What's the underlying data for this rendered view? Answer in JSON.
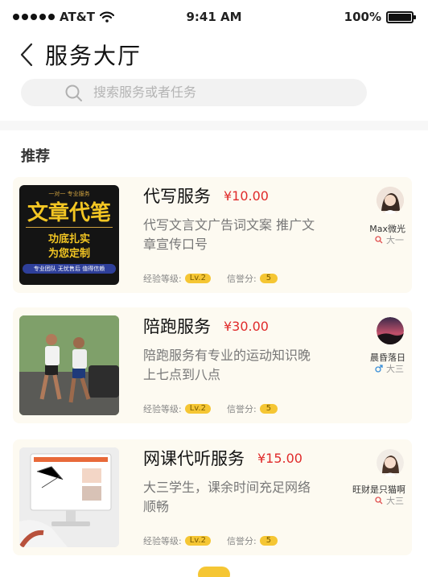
{
  "status_bar": {
    "carrier": "AT&T",
    "time": "9:41 AM",
    "battery": "100%"
  },
  "header": {
    "title": "服务大厅"
  },
  "search": {
    "placeholder": "搜索服务或者任务"
  },
  "section": {
    "title": "推荐"
  },
  "meta_labels": {
    "level": "经验等级:",
    "credit": "信誉分:"
  },
  "cards": [
    {
      "title": "代写服务",
      "price": "¥10.00",
      "description": "代写文言文广告词文案 推广文章宣传口号",
      "level": "Lv.2",
      "credit": "5",
      "user": "Max微光",
      "grade": "大一",
      "thumb": {
        "banner": "一对一 专业服务",
        "headline": "文章代笔",
        "line1": "功底扎实",
        "line2": "为您定制",
        "footer": "专业团队 无忧售后 值得信赖"
      }
    },
    {
      "title": "陪跑服务",
      "price": "¥30.00",
      "description": "陪跑服务有专业的运动知识晚上七点到八点",
      "level": "Lv.2",
      "credit": "5",
      "user": "晨昏落日",
      "grade": "大三"
    },
    {
      "title": "网课代听服务",
      "price": "¥15.00",
      "description": "大三学生，课余时间充足网络顺畅",
      "level": "Lv.2",
      "credit": "5",
      "user": "旺财是只猫啊",
      "grade": "大三"
    }
  ],
  "colors": {
    "accent": "#f5c634",
    "price": "#e02b2b",
    "card_bg": "#fdfaf1"
  }
}
